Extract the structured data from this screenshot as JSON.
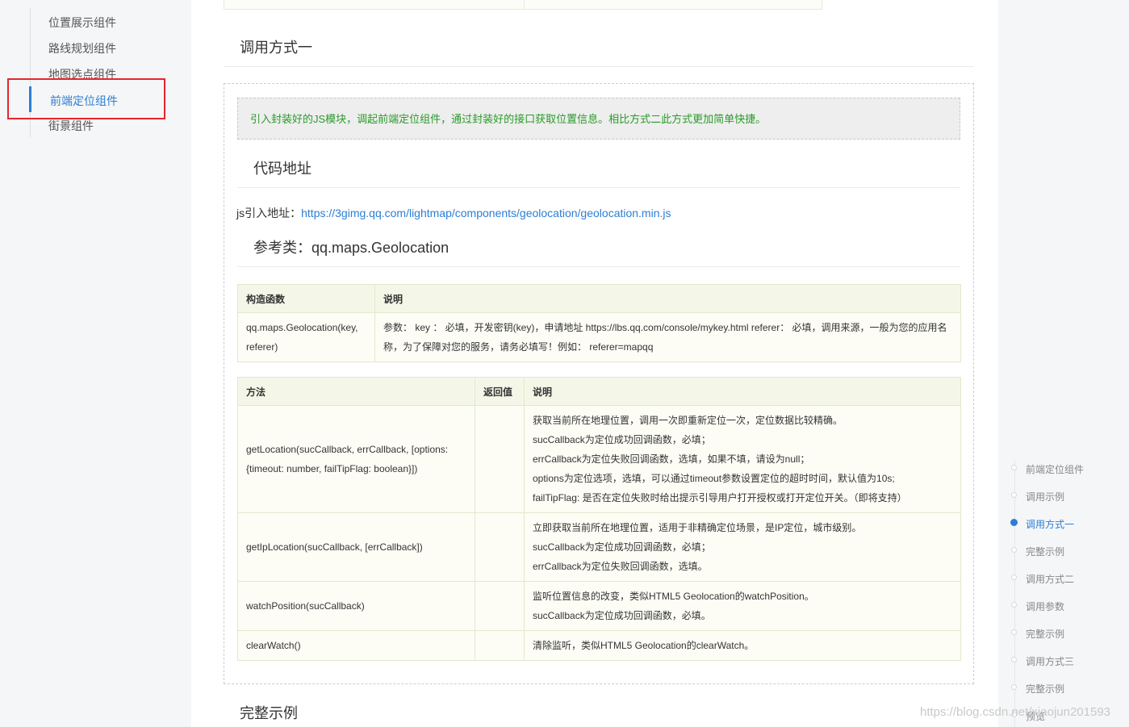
{
  "left_nav": {
    "items": [
      {
        "label": "位置展示组件"
      },
      {
        "label": "路线规划组件"
      },
      {
        "label": "地图选点组件"
      },
      {
        "label": "前端定位组件"
      },
      {
        "label": "街景组件"
      }
    ],
    "active_index": 3
  },
  "main": {
    "section_title": "调用方式一",
    "note": "引入封装好的JS模块，调起前端定位组件，通过封装好的接口获取位置信息。相比方式二此方式更加简单快捷。",
    "code_title": "代码地址",
    "js_prefix": "js引入地址：",
    "js_url": "https://3gimg.qq.com/lightmap/components/geolocation/geolocation.min.js",
    "ref_title": "参考类：qq.maps.Geolocation",
    "ctor_table": {
      "headers": [
        "构造函数",
        "说明"
      ],
      "rows": [
        {
          "name": "qq.maps.Geolocation(key, referer)",
          "desc": "参数： key ： 必填，开发密钥(key)，申请地址 https://lbs.qq.com/console/mykey.html referer： 必填，调用来源，一般为您的应用名称，为了保障对您的服务，请务必填写！例如： referer=mapqq"
        }
      ]
    },
    "method_table": {
      "headers": [
        "方法",
        "返回值",
        "说明"
      ],
      "rows": [
        {
          "name": "getLocation(sucCallback, errCallback, [options: {timeout: number, failTipFlag: boolean}])",
          "ret": "",
          "desc": [
            "获取当前所在地理位置，调用一次即重新定位一次，定位数据比较精确。",
            "sucCallback为定位成功回调函数，必填；",
            "errCallback为定位失败回调函数，选填，如果不填，请设为null；",
            "options为定位选项，选填，可以通过timeout参数设置定位的超时时间，默认值为10s;",
            "failTipFlag: 是否在定位失败时给出提示引导用户打开授权或打开定位开关。（即将支持）"
          ]
        },
        {
          "name": "getIpLocation(sucCallback, [errCallback])",
          "ret": "",
          "desc": [
            "立即获取当前所在地理位置，适用于非精确定位场景，是IP定位，城市级别。",
            "sucCallback为定位成功回调函数，必填；",
            "errCallback为定位失败回调函数，选填。"
          ]
        },
        {
          "name": "watchPosition(sucCallback)",
          "ret": "",
          "desc": [
            "监听位置信息的改变，类似HTML5 Geolocation的watchPosition。",
            "sucCallback为定位成功回调函数，必填。"
          ]
        },
        {
          "name": "clearWatch()",
          "ret": "",
          "desc": [
            "清除监听，类似HTML5 Geolocation的clearWatch。"
          ]
        }
      ]
    },
    "next_section_title": "完整示例"
  },
  "toc": {
    "items": [
      {
        "label": "前端定位组件"
      },
      {
        "label": "调用示例"
      },
      {
        "label": "调用方式一"
      },
      {
        "label": "完整示例"
      },
      {
        "label": "调用方式二"
      },
      {
        "label": "调用参数"
      },
      {
        "label": "完整示例"
      },
      {
        "label": "调用方式三"
      },
      {
        "label": "完整示例"
      },
      {
        "label": "预览"
      }
    ],
    "active_index": 2
  },
  "watermark": "https://blog.csdn.net/xiaojun201593",
  "colors": {
    "accent": "#2d7ed4",
    "note_text": "#2a9a2a",
    "highlight_box": "#e8252d"
  }
}
